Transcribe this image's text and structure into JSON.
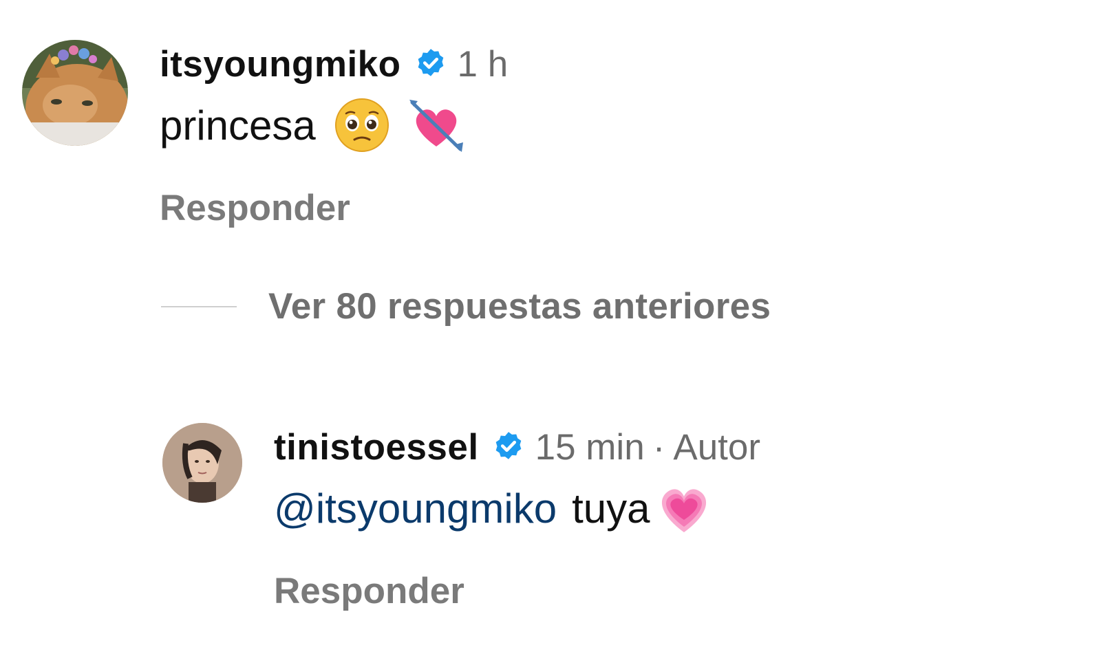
{
  "comments": [
    {
      "username": "itsyoungmiko",
      "time": "1 h",
      "text": "princesa",
      "emojis": [
        "pleading-face",
        "heart-with-arrow"
      ],
      "reply_label": "Responder",
      "avatar": "cat-with-flower-crown"
    },
    {
      "username": "tinistoessel",
      "time": "15 min",
      "separator": "·",
      "role": "Autor",
      "mention": "@itsyoungmiko",
      "text": "tuya",
      "emojis": [
        "growing-heart"
      ],
      "reply_label": "Responder",
      "avatar": "woman-portrait"
    }
  ],
  "view_more": {
    "label": "Ver 80 respuestas anteriores"
  },
  "colors": {
    "username": "#111111",
    "meta": "#6b6b6b",
    "mention": "#0b3a6b",
    "reply": "#7a7a7a",
    "verified": "#1d9bf0"
  }
}
